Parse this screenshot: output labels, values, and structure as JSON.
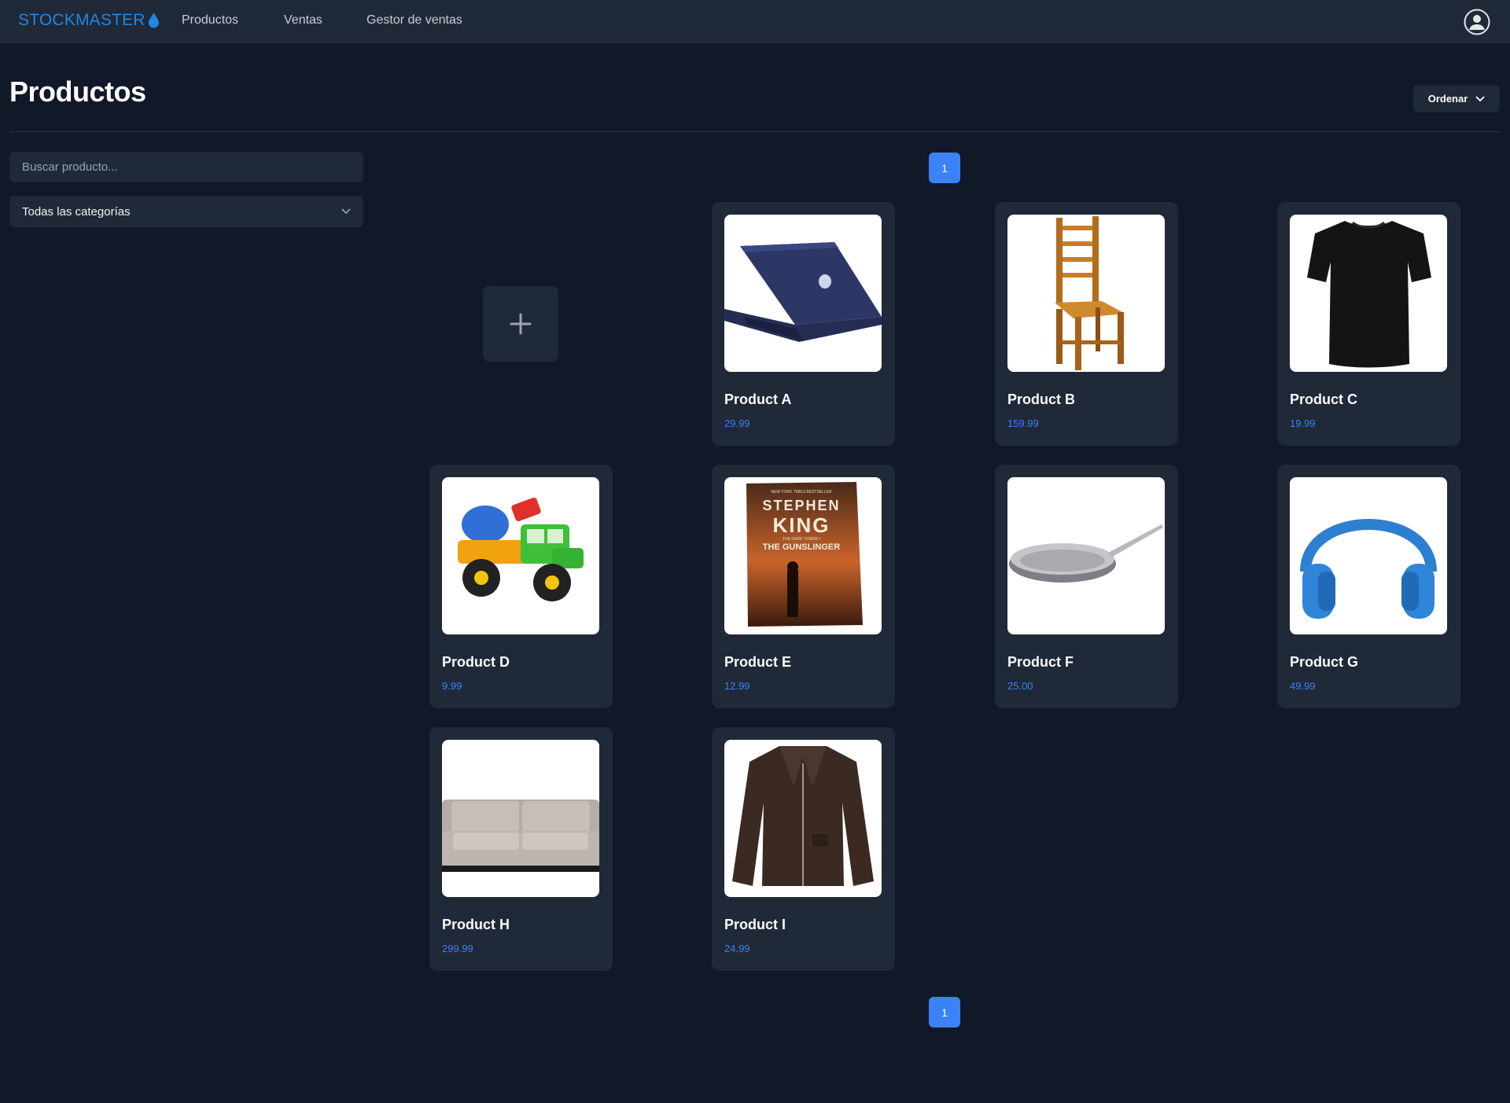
{
  "navbar": {
    "brand": "STOCKMASTER",
    "links": [
      "Productos",
      "Ventas",
      "Gestor de ventas"
    ],
    "user_icon": "user-circle-icon",
    "brand_color": "#1e88e5"
  },
  "header": {
    "title": "Productos",
    "sort_label": "Ordenar"
  },
  "filters": {
    "search_placeholder": "Buscar producto...",
    "search_value": "",
    "category_selected": "Todas las categorías"
  },
  "pagination": {
    "current_page": "1"
  },
  "add_button": {
    "icon": "plus-icon"
  },
  "products": [
    {
      "name": "Product A",
      "price": "29.99",
      "image": "laptop"
    },
    {
      "name": "Product B",
      "price": "159.99",
      "image": "wooden-chair"
    },
    {
      "name": "Product C",
      "price": "19.99",
      "image": "black-tshirt"
    },
    {
      "name": "Product D",
      "price": "9.99",
      "image": "toy-truck"
    },
    {
      "name": "Product E",
      "price": "12.99",
      "image": "book-cover"
    },
    {
      "name": "Product F",
      "price": "25.00",
      "image": "frying-pan"
    },
    {
      "name": "Product G",
      "price": "49.99",
      "image": "headphones"
    },
    {
      "name": "Product H",
      "price": "299.99",
      "image": "sofa"
    },
    {
      "name": "Product I",
      "price": "24.99",
      "image": "leather-jacket"
    }
  ],
  "book_cover_text": {
    "top": "NEW YORK TIMES BESTSELLER",
    "author_first": "STEPHEN",
    "author_last": "KING",
    "series": "THE DARK TOWER I",
    "title": "THE GUNSLINGER"
  },
  "colors": {
    "background": "#111827",
    "surface": "#1f2937",
    "accent": "#3b82f6"
  }
}
